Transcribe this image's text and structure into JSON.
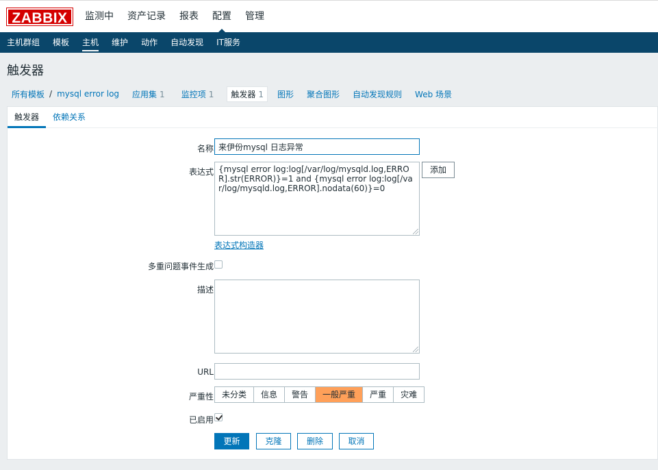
{
  "logo": "ZABBIX",
  "main_nav": [
    "监测中",
    "资产记录",
    "报表",
    "配置",
    "管理"
  ],
  "main_nav_active": 3,
  "sub_nav": [
    "主机群组",
    "模板",
    "主机",
    "维护",
    "动作",
    "自动发现",
    "IT服务"
  ],
  "sub_nav_active": 2,
  "page_title": "触发器",
  "breadcrumb": {
    "all_templates": "所有模板",
    "separator": "/",
    "template": "mysql error log",
    "applications": {
      "label": "应用集",
      "count": "1"
    },
    "items": {
      "label": "监控项",
      "count": "1"
    },
    "triggers": {
      "label": "触发器",
      "count": "1"
    },
    "graphs": "图形",
    "screens": "聚合图形",
    "discovery": "自动发现规则",
    "web": "Web 场景"
  },
  "form_tabs": [
    "触发器",
    "依赖关系"
  ],
  "form": {
    "name_label": "名称",
    "name_value": "来伊份mysql 日志异常",
    "expression_label": "表达式",
    "expression_value": "{mysql error log:log[/var/log/mysqld.log,ERROR].str(ERROR)}=1 and {mysql error log:log[/var/log/mysqld.log,ERROR].nodata(60)}=0",
    "add_button": "添加",
    "expression_builder": "表达式构造器",
    "multiple_events_label": "多重问题事件生成",
    "multiple_events_checked": false,
    "description_label": "描述",
    "description_value": "",
    "url_label": "URL",
    "url_value": "",
    "severity_label": "严重性",
    "severity_options": [
      "未分类",
      "信息",
      "警告",
      "一般严重",
      "严重",
      "灾难"
    ],
    "severity_selected": 3,
    "enabled_label": "已启用",
    "enabled_checked": true
  },
  "buttons": {
    "update": "更新",
    "clone": "克隆",
    "delete": "删除",
    "cancel": "取消"
  },
  "colors": {
    "header_blue": "#0a466a",
    "link_blue": "#0275b8",
    "logo_red": "#d40000",
    "severity_average": "#ffa059"
  }
}
